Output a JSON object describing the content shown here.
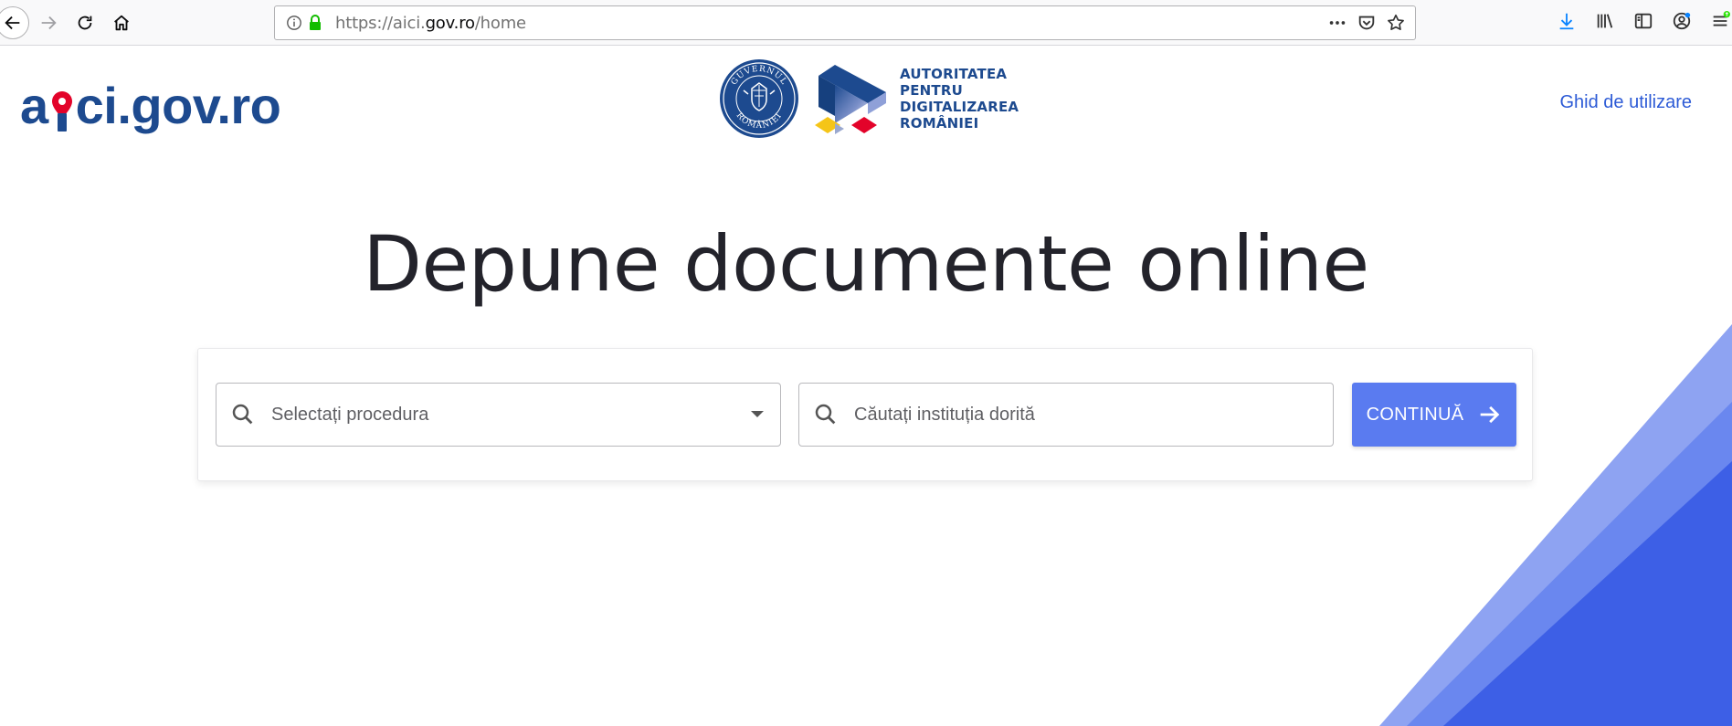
{
  "browser": {
    "url_prefix": "https://aici.",
    "url_host": "gov.ro",
    "url_path": "/home"
  },
  "header": {
    "logo_left": "a",
    "logo_right": "ci.gov.ro",
    "seal_text_top": "GUVERNUL",
    "seal_text_bottom": "ROMÂNIEI",
    "adr_lines": [
      "AUTORITATEA",
      "PENTRU",
      "DIGITALIZAREA",
      "ROMÂNIEI"
    ],
    "guide_link": "Ghid de utilizare"
  },
  "hero": {
    "title": "Depune documente online"
  },
  "search": {
    "procedure_placeholder": "Selectați procedura",
    "institution_placeholder": "Căutați instituția dorită",
    "continue_label": "CONTINUĂ"
  },
  "colors": {
    "brand_blue": "#1d4a8f",
    "button_blue": "#5a7bf0",
    "pin_red": "#e3032a",
    "deco_light": "#8ea3f2",
    "deco_mid": "#6a87ef",
    "deco_dark": "#3d5fe6"
  }
}
